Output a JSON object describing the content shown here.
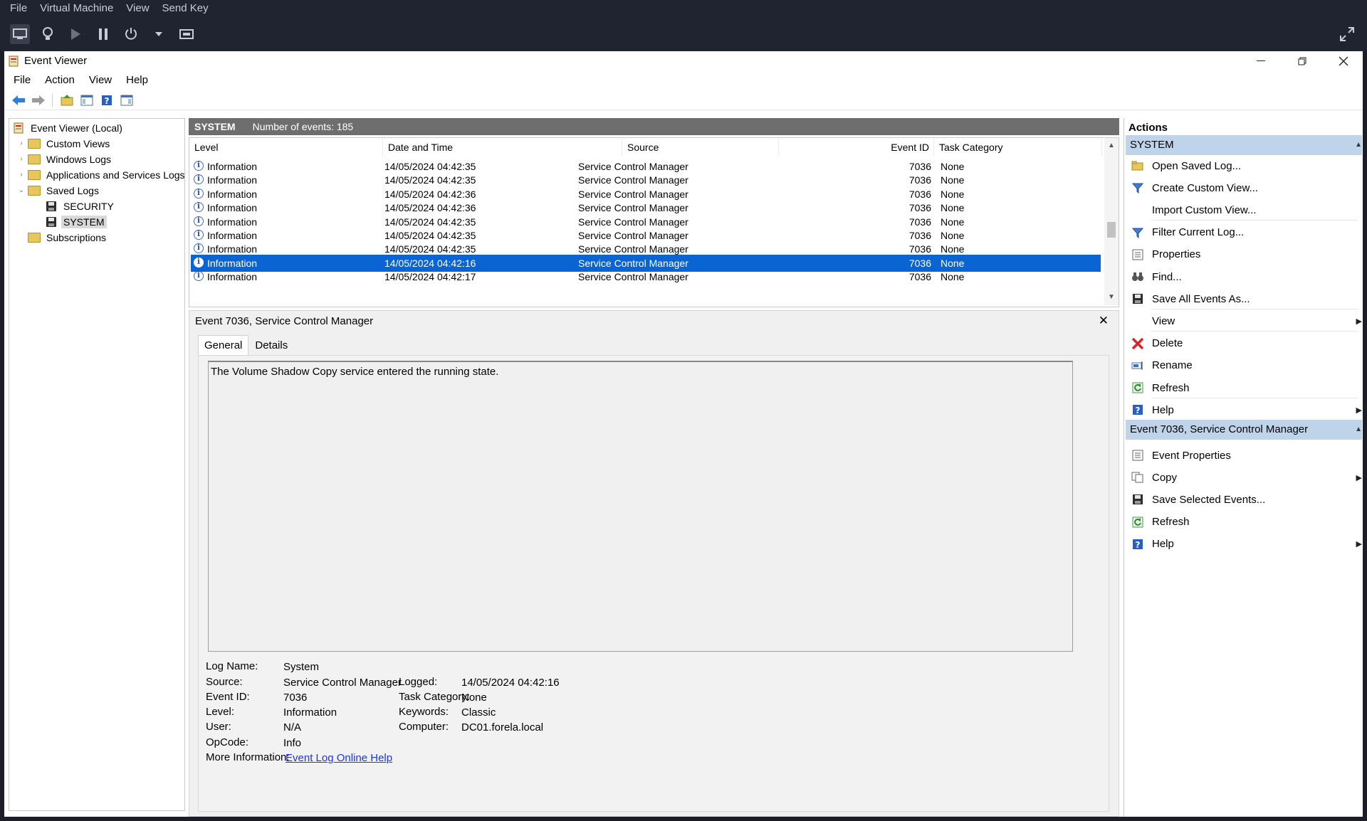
{
  "vm": {
    "menu": [
      "File",
      "Virtual Machine",
      "View",
      "Send Key"
    ]
  },
  "window": {
    "title": "Event Viewer",
    "menu": [
      "File",
      "Action",
      "View",
      "Help"
    ]
  },
  "tree": {
    "root": "Event Viewer (Local)",
    "custom_views": "Custom Views",
    "windows_logs": "Windows Logs",
    "apps_services": "Applications and Services Logs",
    "saved_logs": "Saved Logs",
    "security": "SECURITY",
    "system": "SYSTEM",
    "subscriptions": "Subscriptions"
  },
  "log": {
    "name": "SYSTEM",
    "count_text": "Number of events: 185"
  },
  "grid": {
    "columns": [
      "Level",
      "Date and Time",
      "Source",
      "Event ID",
      "Task Category"
    ],
    "rows": [
      {
        "level": "Information",
        "date": "14/05/2024 04:42:35",
        "source": "Service Control Manager",
        "id": "7036",
        "task": "None"
      },
      {
        "level": "Information",
        "date": "14/05/2024 04:42:35",
        "source": "Service Control Manager",
        "id": "7036",
        "task": "None"
      },
      {
        "level": "Information",
        "date": "14/05/2024 04:42:36",
        "source": "Service Control Manager",
        "id": "7036",
        "task": "None"
      },
      {
        "level": "Information",
        "date": "14/05/2024 04:42:36",
        "source": "Service Control Manager",
        "id": "7036",
        "task": "None"
      },
      {
        "level": "Information",
        "date": "14/05/2024 04:42:35",
        "source": "Service Control Manager",
        "id": "7036",
        "task": "None"
      },
      {
        "level": "Information",
        "date": "14/05/2024 04:42:35",
        "source": "Service Control Manager",
        "id": "7036",
        "task": "None"
      },
      {
        "level": "Information",
        "date": "14/05/2024 04:42:35",
        "source": "Service Control Manager",
        "id": "7036",
        "task": "None"
      },
      {
        "level": "Information",
        "date": "14/05/2024 04:42:16",
        "source": "Service Control Manager",
        "id": "7036",
        "task": "None"
      },
      {
        "level": "Information",
        "date": "14/05/2024 04:42:17",
        "source": "Service Control Manager",
        "id": "7036",
        "task": "None"
      }
    ],
    "selected_index": 7
  },
  "detail": {
    "title": "Event 7036, Service Control Manager",
    "tabs": [
      "General",
      "Details"
    ],
    "description": "The Volume Shadow Copy service entered the running state.",
    "labels": {
      "log_name": "Log Name:",
      "source": "Source:",
      "event_id": "Event ID:",
      "level": "Level:",
      "user": "User:",
      "opcode": "OpCode:",
      "more_info": "More Information:",
      "logged": "Logged:",
      "task_category": "Task Category:",
      "keywords": "Keywords:",
      "computer": "Computer:"
    },
    "values": {
      "log_name": "System",
      "source": "Service Control Manager",
      "event_id": "7036",
      "level": "Information",
      "user": "N/A",
      "opcode": "Info",
      "more_info": "Event Log Online Help",
      "logged": "14/05/2024 04:42:16",
      "task_category": "None",
      "keywords": "Classic",
      "computer": "DC01.forela.local"
    }
  },
  "actions": {
    "title": "Actions",
    "group1": {
      "header": "SYSTEM",
      "items": [
        {
          "label": "Open Saved Log...",
          "icon": "folder-open-icon"
        },
        {
          "label": "Create Custom View...",
          "icon": "filter-icon"
        },
        {
          "label": "Import Custom View...",
          "icon": ""
        },
        {
          "label": "Filter Current Log...",
          "icon": "filter-icon"
        },
        {
          "label": "Properties",
          "icon": "properties-icon"
        },
        {
          "label": "Find...",
          "icon": "binoculars-icon"
        },
        {
          "label": "Save All Events As...",
          "icon": "save-icon"
        },
        {
          "label": "View",
          "icon": "",
          "submenu": true
        },
        {
          "label": "Delete",
          "icon": "delete-icon"
        },
        {
          "label": "Rename",
          "icon": "rename-icon"
        },
        {
          "label": "Refresh",
          "icon": "refresh-icon"
        },
        {
          "label": "Help",
          "icon": "help-icon",
          "submenu": true
        }
      ]
    },
    "group2": {
      "header": "Event 7036, Service Control Manager",
      "items": [
        {
          "label": "Event Properties",
          "icon": "properties-icon"
        },
        {
          "label": "Copy",
          "icon": "copy-icon",
          "submenu": true
        },
        {
          "label": "Save Selected Events...",
          "icon": "save-icon"
        },
        {
          "label": "Refresh",
          "icon": "refresh-icon"
        },
        {
          "label": "Help",
          "icon": "help-icon",
          "submenu": true
        }
      ]
    }
  },
  "colors": {
    "selection": "#0a64d2",
    "log_header": "#6e6e6e",
    "action_group_header": "#bfd4ea",
    "vm_chrome": "#1f2430"
  }
}
